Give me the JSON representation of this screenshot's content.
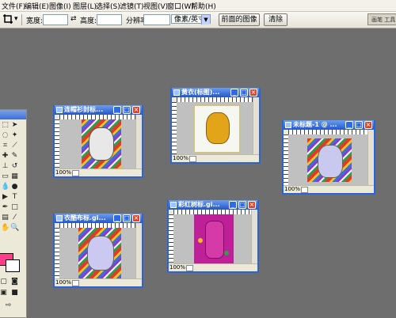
{
  "menu": {
    "items": [
      "文件(F)",
      "编辑(E)",
      "图像(I)",
      "图层(L)",
      "选择(S)",
      "滤镜(T)",
      "视图(V)",
      "窗口(W)",
      "帮助(H)"
    ]
  },
  "options": {
    "width_label": "宽度:",
    "height_label": "高度:",
    "resolution_label": "分辨率:",
    "unit_value": "像素/英寸",
    "front_image_button": "前面的图像",
    "clear_button": "清除",
    "palette_label": "画笔 工具"
  },
  "docs": [
    {
      "title": "连帽衫封标...",
      "zoom": "100%"
    },
    {
      "title": "黄衣(标图)...",
      "zoom": "100%"
    },
    {
      "title": "未标题-1 @ ...",
      "zoom": "100%"
    },
    {
      "title": "衣酷布标.gi...",
      "zoom": "100%"
    },
    {
      "title": "彩红树标.gi...",
      "zoom": "100%"
    }
  ],
  "icons": {
    "crop_tool": "crop-icon",
    "minimize": "minimize-icon",
    "maximize": "maximize-icon",
    "close": "close-icon"
  },
  "colors": {
    "foreground": "#ff3d8b",
    "background": "#ffffff",
    "workspace": "#6e6e6e",
    "titlebar": "#2456c8"
  }
}
